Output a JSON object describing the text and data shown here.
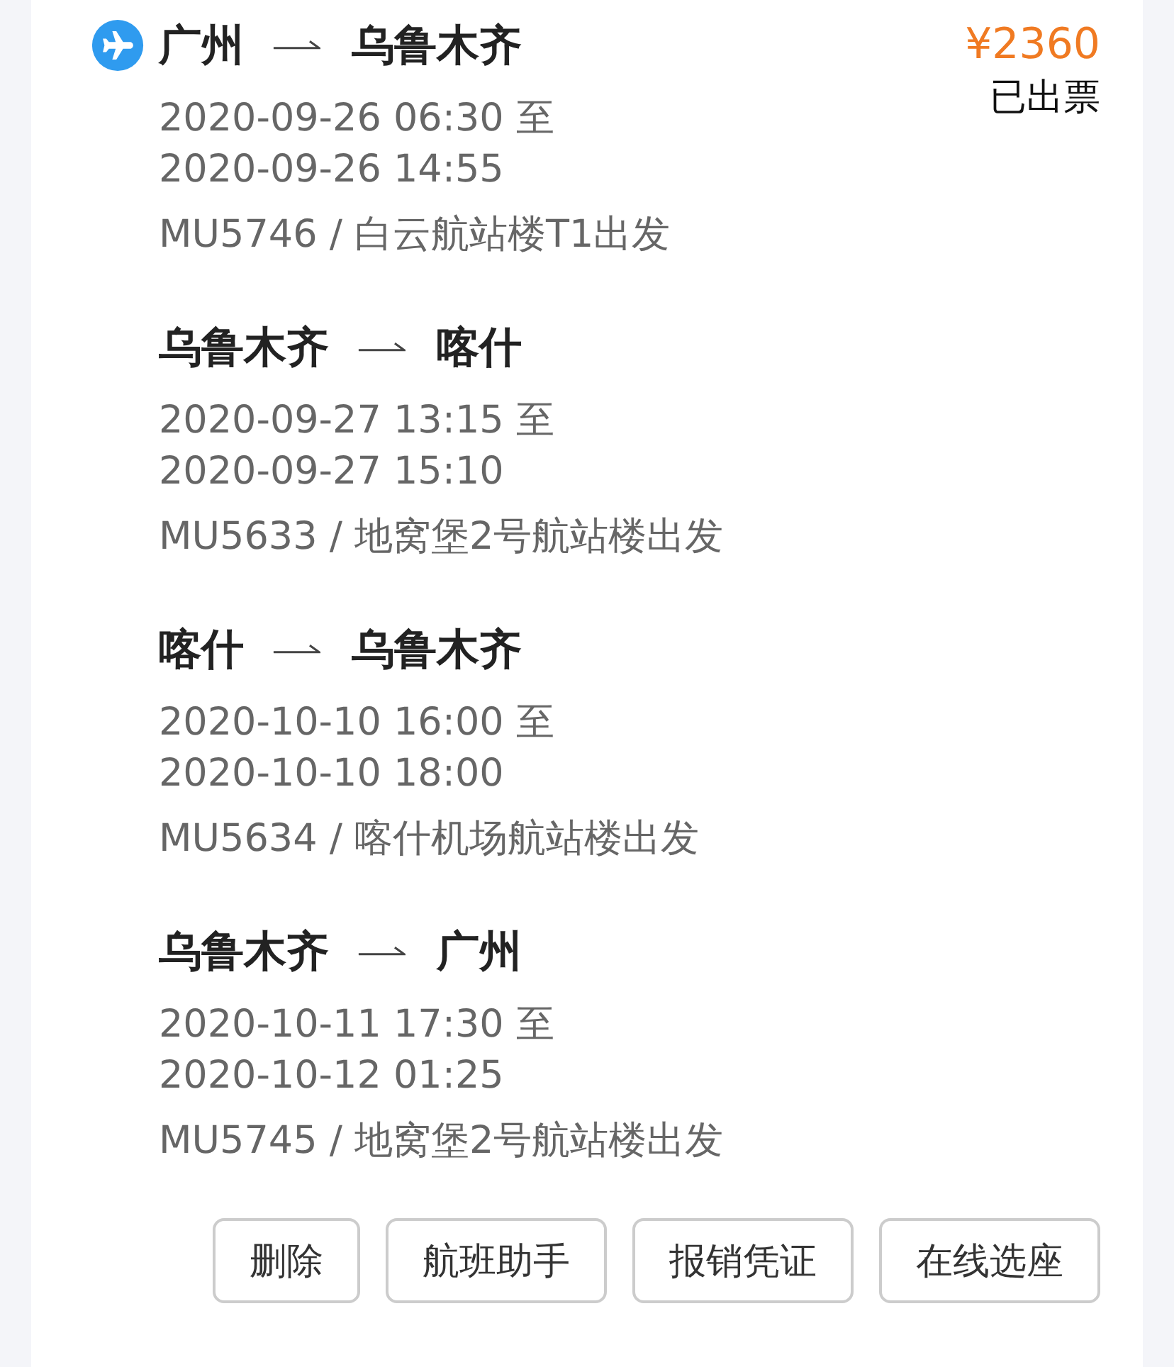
{
  "order": {
    "price": "¥2360",
    "status": "已出票",
    "segments": [
      {
        "from": "广州",
        "to": "乌鲁木齐",
        "depart": "2020-09-26 06:30 至",
        "arrive": "2020-09-26 14:55",
        "flight": "MU5746 / 白云航站楼T1出发"
      },
      {
        "from": "乌鲁木齐",
        "to": "喀什",
        "depart": "2020-09-27 13:15 至",
        "arrive": "2020-09-27 15:10",
        "flight": "MU5633 / 地窝堡2号航站楼出发"
      },
      {
        "from": "喀什",
        "to": "乌鲁木齐",
        "depart": "2020-10-10 16:00 至",
        "arrive": "2020-10-10 18:00",
        "flight": "MU5634 / 喀什机场航站楼出发"
      },
      {
        "from": "乌鲁木齐",
        "to": "广州",
        "depart": "2020-10-11 17:30 至",
        "arrive": "2020-10-12 01:25",
        "flight": "MU5745 / 地窝堡2号航站楼出发"
      }
    ],
    "buttons": [
      "删除",
      "航班助手",
      "报销凭证",
      "在线选座"
    ]
  }
}
